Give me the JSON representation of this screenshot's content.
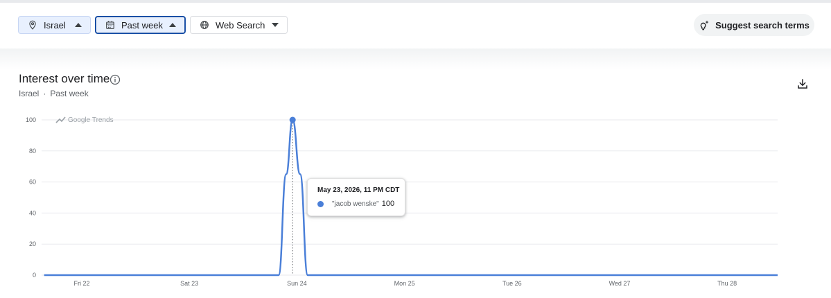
{
  "filters": {
    "geo": {
      "label": "Israel",
      "icon": "location-pin-icon"
    },
    "time": {
      "label": "Past week",
      "icon": "calendar-icon"
    },
    "property": {
      "label": "Web Search",
      "icon": "globe-icon"
    }
  },
  "suggest": {
    "label": "Suggest search terms",
    "icon": "sparkle-lightbulb-icon"
  },
  "card": {
    "title": "Interest over time",
    "subtitle_geo": "Israel",
    "subtitle_sep": "·",
    "subtitle_time": "Past week"
  },
  "tooltip": {
    "date": "May 23, 2026, 11 PM CDT",
    "term": "\"jacob wenske\"",
    "value": "100"
  },
  "colors": {
    "series": "#4a7fd8",
    "accent": "#174ea6",
    "grid": "#e8eaed"
  },
  "chart_data": {
    "type": "line",
    "watermark": "Google Trends",
    "ylim": [
      0,
      100
    ],
    "yticks": [
      0,
      20,
      40,
      60,
      80,
      100
    ],
    "x_tick_labels": [
      "Fri 22",
      "Sat 23",
      "Sun 24",
      "Mon 25",
      "Tue 26",
      "Wed 27",
      "Thu 28"
    ],
    "x_range_days": [
      0,
      6.5
    ],
    "x_tick_positions_days": [
      0,
      1,
      2,
      3,
      4,
      5,
      6
    ],
    "series": [
      {
        "name": "\"jacob wenske\"",
        "points": [
          {
            "x": -0.35,
            "y": 0
          },
          {
            "x": 1.75,
            "y": 0
          },
          {
            "x": 1.83,
            "y": 0
          },
          {
            "x": 1.9,
            "y": 65
          },
          {
            "x": 1.96,
            "y": 100
          },
          {
            "x": 2.03,
            "y": 65
          },
          {
            "x": 2.1,
            "y": 0
          },
          {
            "x": 6.5,
            "y": 0
          }
        ]
      }
    ],
    "highlight": {
      "x": 1.96,
      "y": 100
    }
  }
}
